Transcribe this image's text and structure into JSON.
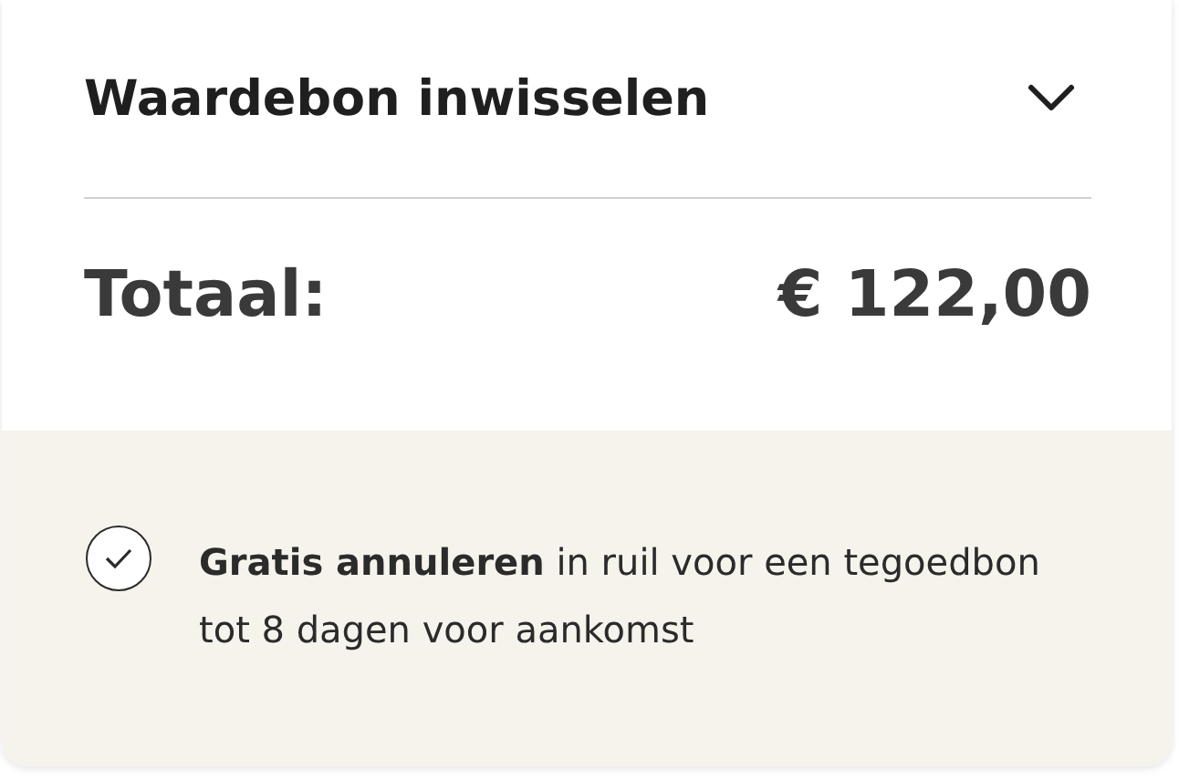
{
  "voucher": {
    "title": "Waardebon inwisselen",
    "expanded": false
  },
  "total": {
    "label": "Totaal:",
    "amount": "€ 122,00"
  },
  "notice": {
    "checked": true,
    "text": "**Gratis annuleren** in ruil voor een tegoedbon tot 8 dagen voor aankomst"
  }
}
